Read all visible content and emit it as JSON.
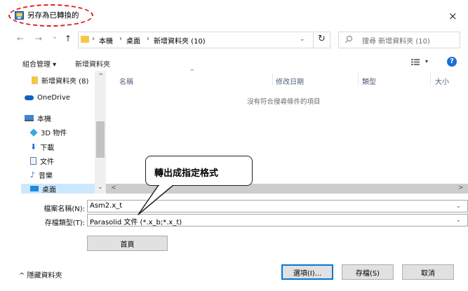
{
  "window": {
    "title": "另存為已轉換的",
    "close_glyph": "×"
  },
  "navigation": {
    "back": "←",
    "forward": "→",
    "history": "⌄",
    "up": "↑"
  },
  "address_bar": {
    "segments": [
      "本機",
      "桌面",
      "新增資料夾 (10)"
    ],
    "separator": "›",
    "dropdown": "⌄",
    "refresh": "↻"
  },
  "search": {
    "placeholder": "搜尋 新增資料夾 (10)"
  },
  "toolbar": {
    "organize": "組合管理 ▾",
    "new_folder": "新增資料夾",
    "view_dropdown": "▾",
    "help": "?"
  },
  "nav_pane": {
    "items": [
      {
        "label": "新增資料夾 (8)",
        "icon": "folder-icon"
      },
      {
        "label": "OneDrive",
        "icon": "cloud-icon"
      },
      {
        "label": "本機",
        "icon": "computer-icon"
      },
      {
        "label": "3D 物件",
        "icon": "cube-icon"
      },
      {
        "label": "下載",
        "icon": "download-icon"
      },
      {
        "label": "文件",
        "icon": "document-icon"
      },
      {
        "label": "音樂",
        "icon": "music-icon"
      },
      {
        "label": "桌面",
        "icon": "desktop-icon",
        "selected": true
      }
    ],
    "scroll_up": "^",
    "scroll_down": "⌄"
  },
  "file_list": {
    "columns": [
      "名稱",
      "修改日期",
      "類型",
      "大小"
    ],
    "sort_indicator": "^",
    "empty_message": "沒有符合搜尋條件的項目",
    "scroll_left": "<",
    "scroll_right": ">"
  },
  "form": {
    "filename_label": "檔案名稱(N):",
    "filename_value": "Asm2.x_t",
    "filetype_label": "存檔類型(T):",
    "filetype_value": "Parasolid 文件 (*.x_b;*.x_t)",
    "dropdown": "⌄",
    "first_page_button": "首頁"
  },
  "footer": {
    "hide_folders": "^ 隱藏資料夾",
    "options_button": "選項(I)...",
    "save_button": "存檔(S)",
    "cancel_button": "取消"
  },
  "annotation": {
    "callout_text": "轉出成指定格式",
    "highlight_color": "#e0201c"
  }
}
